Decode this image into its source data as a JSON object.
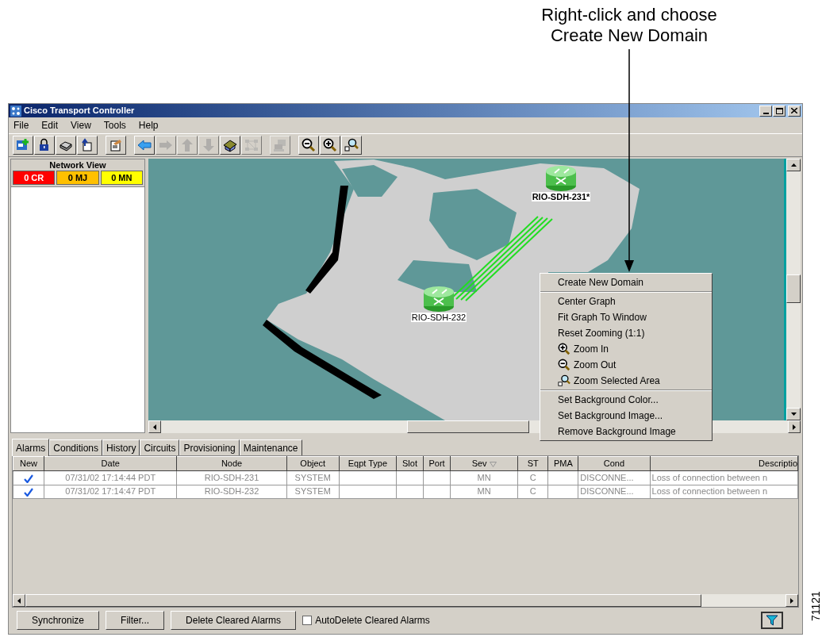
{
  "callout": {
    "line_1": "Right-click and choose",
    "line_2": "Create New Domain"
  },
  "window": {
    "title": "Cisco Transport Controller"
  },
  "menu_bar": [
    "File",
    "Edit",
    "View",
    "Tools",
    "Help"
  ],
  "toolbar": [
    {
      "kind": "add-node",
      "disabled": false
    },
    {
      "kind": "lock",
      "disabled": false
    },
    {
      "kind": "print",
      "disabled": false
    },
    {
      "kind": "export",
      "disabled": false
    },
    {
      "kind": "separator"
    },
    {
      "kind": "preferences",
      "disabled": false
    },
    {
      "kind": "separator"
    },
    {
      "kind": "back",
      "disabled": false
    },
    {
      "kind": "forward",
      "disabled": true
    },
    {
      "kind": "up",
      "disabled": true
    },
    {
      "kind": "down",
      "disabled": true
    },
    {
      "kind": "home",
      "disabled": false
    },
    {
      "kind": "network",
      "disabled": true
    },
    {
      "kind": "separator"
    },
    {
      "kind": "monitor",
      "disabled": true
    },
    {
      "kind": "separator"
    },
    {
      "kind": "zoom-out",
      "disabled": false
    },
    {
      "kind": "zoom-in",
      "disabled": false
    },
    {
      "kind": "zoom-area",
      "disabled": false
    }
  ],
  "network_view": {
    "title": "Network View",
    "alarm_counts": [
      {
        "label": "0 CR",
        "color": "#ff0000"
      },
      {
        "label": "0 MJ",
        "color": "#ffc000"
      },
      {
        "label": "0 MN",
        "color": "#ffff00"
      }
    ]
  },
  "map": {
    "nodes": [
      {
        "label": "RIO-SDH-231*"
      },
      {
        "label": "RIO-SDH-232"
      }
    ]
  },
  "context_menu": [
    {
      "kind": "plain",
      "label": "Create New Domain"
    },
    {
      "kind": "separator"
    },
    {
      "kind": "plain",
      "label": "Center Graph"
    },
    {
      "kind": "plain",
      "label": "Fit Graph To Window"
    },
    {
      "kind": "plain",
      "label": "Reset Zooming (1:1)"
    },
    {
      "kind": "zoomin",
      "label": "Zoom In"
    },
    {
      "kind": "zoomout",
      "label": "Zoom Out"
    },
    {
      "kind": "zoomarea",
      "label": "Zoom Selected Area"
    },
    {
      "kind": "separator"
    },
    {
      "kind": "plain",
      "label": "Set Background Color..."
    },
    {
      "kind": "plain",
      "label": "Set Background Image..."
    },
    {
      "kind": "plain",
      "label": "Remove Background Image"
    }
  ],
  "tabs": [
    {
      "label": "Alarms",
      "selected": true
    },
    {
      "label": "Conditions",
      "selected": false
    },
    {
      "label": "History",
      "selected": false
    },
    {
      "label": "Circuits",
      "selected": false
    },
    {
      "label": "Provisioning",
      "selected": false
    },
    {
      "label": "Maintenance",
      "selected": false
    }
  ],
  "table": {
    "columns": [
      {
        "label": "New",
        "sorted": false
      },
      {
        "label": "Date",
        "sorted": false
      },
      {
        "label": "Node",
        "sorted": false
      },
      {
        "label": "Object",
        "sorted": false
      },
      {
        "label": "Eqpt Type",
        "sorted": false
      },
      {
        "label": "Slot",
        "sorted": false
      },
      {
        "label": "Port",
        "sorted": false
      },
      {
        "label": "Sev",
        "sorted": true
      },
      {
        "label": "ST",
        "sorted": false
      },
      {
        "label": "PMA",
        "sorted": false
      },
      {
        "label": "Cond",
        "sorted": false
      },
      {
        "label": "Descriptio",
        "sorted": false
      }
    ],
    "rows": [
      {
        "new": true,
        "cells": [
          "",
          "07/31/02 17:14:44 PDT",
          "RIO-SDH-231",
          "SYSTEM",
          "",
          "",
          "",
          "MN",
          "C",
          "",
          "DISCONNE...",
          "Loss of connection between n"
        ]
      },
      {
        "new": true,
        "cells": [
          "",
          "07/31/02 17:14:47 PDT",
          "RIO-SDH-232",
          "SYSTEM",
          "",
          "",
          "",
          "MN",
          "C",
          "",
          "DISCONNE...",
          "Loss of connection between n"
        ]
      }
    ]
  },
  "buttons": [
    "Synchronize",
    "Filter...",
    "Delete Cleared Alarms"
  ],
  "auto_delete": {
    "label": "AutoDelete Cleared Alarms",
    "checked": false
  },
  "figure_number": "71121"
}
